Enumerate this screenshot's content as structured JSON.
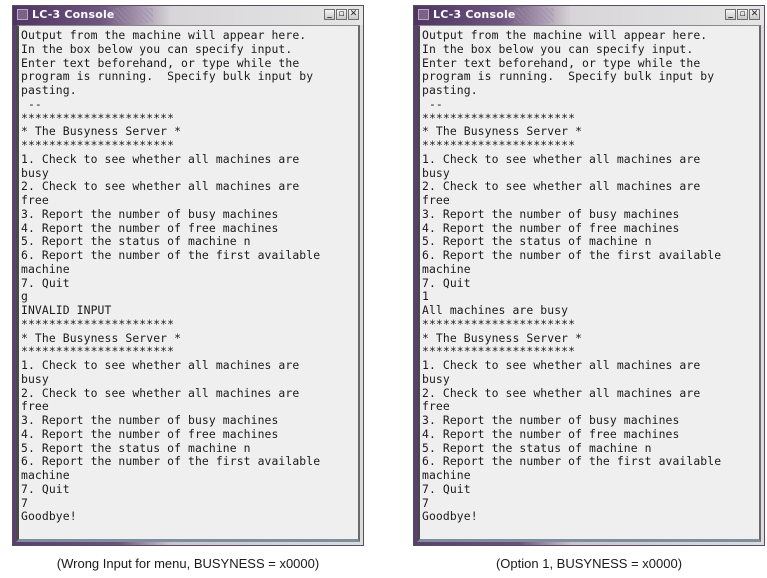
{
  "windows": [
    {
      "title": "LC-3 Console",
      "buttons": {
        "minimize": "_",
        "maximize": "▫",
        "close": "✕"
      },
      "lines": [
        "Output from the machine will appear here.",
        "In the box below you can specify input.",
        "Enter text beforehand, or type while the",
        "program is running.  Specify bulk input by",
        "pasting.",
        " --",
        "**********************",
        "* The Busyness Server *",
        "**********************",
        "1. Check to see whether all machines are",
        "busy",
        "2. Check to see whether all machines are",
        "free",
        "3. Report the number of busy machines",
        "4. Report the number of free machines",
        "5. Report the status of machine n",
        "6. Report the number of the first available",
        "machine",
        "7. Quit",
        "g",
        "INVALID INPUT",
        "**********************",
        "* The Busyness Server *",
        "**********************",
        "1. Check to see whether all machines are",
        "busy",
        "2. Check to see whether all machines are",
        "free",
        "3. Report the number of busy machines",
        "4. Report the number of free machines",
        "5. Report the status of machine n",
        "6. Report the number of the first available",
        "machine",
        "7. Quit",
        "7",
        "Goodbye!"
      ],
      "caption": "(Wrong Input for menu,  BUSYNESS = x0000)"
    },
    {
      "title": "LC-3 Console",
      "buttons": {
        "minimize": "_",
        "maximize": "▫",
        "close": "✕"
      },
      "lines": [
        "Output from the machine will appear here.",
        "In the box below you can specify input.",
        "Enter text beforehand, or type while the",
        "program is running.  Specify bulk input by",
        "pasting.",
        " --",
        "**********************",
        "* The Busyness Server *",
        "**********************",
        "1. Check to see whether all machines are",
        "busy",
        "2. Check to see whether all machines are",
        "free",
        "3. Report the number of busy machines",
        "4. Report the number of free machines",
        "5. Report the status of machine n",
        "6. Report the number of the first available",
        "machine",
        "7. Quit",
        "1",
        "All machines are busy",
        "**********************",
        "* The Busyness Server *",
        "**********************",
        "1. Check to see whether all machines are",
        "busy",
        "2. Check to see whether all machines are",
        "free",
        "3. Report the number of busy machines",
        "4. Report the number of free machines",
        "5. Report the status of machine n",
        "6. Report the number of the first available",
        "machine",
        "7. Quit",
        "7",
        "Goodbye!"
      ],
      "caption": "(Option 1, BUSYNESS = x0000)"
    }
  ]
}
